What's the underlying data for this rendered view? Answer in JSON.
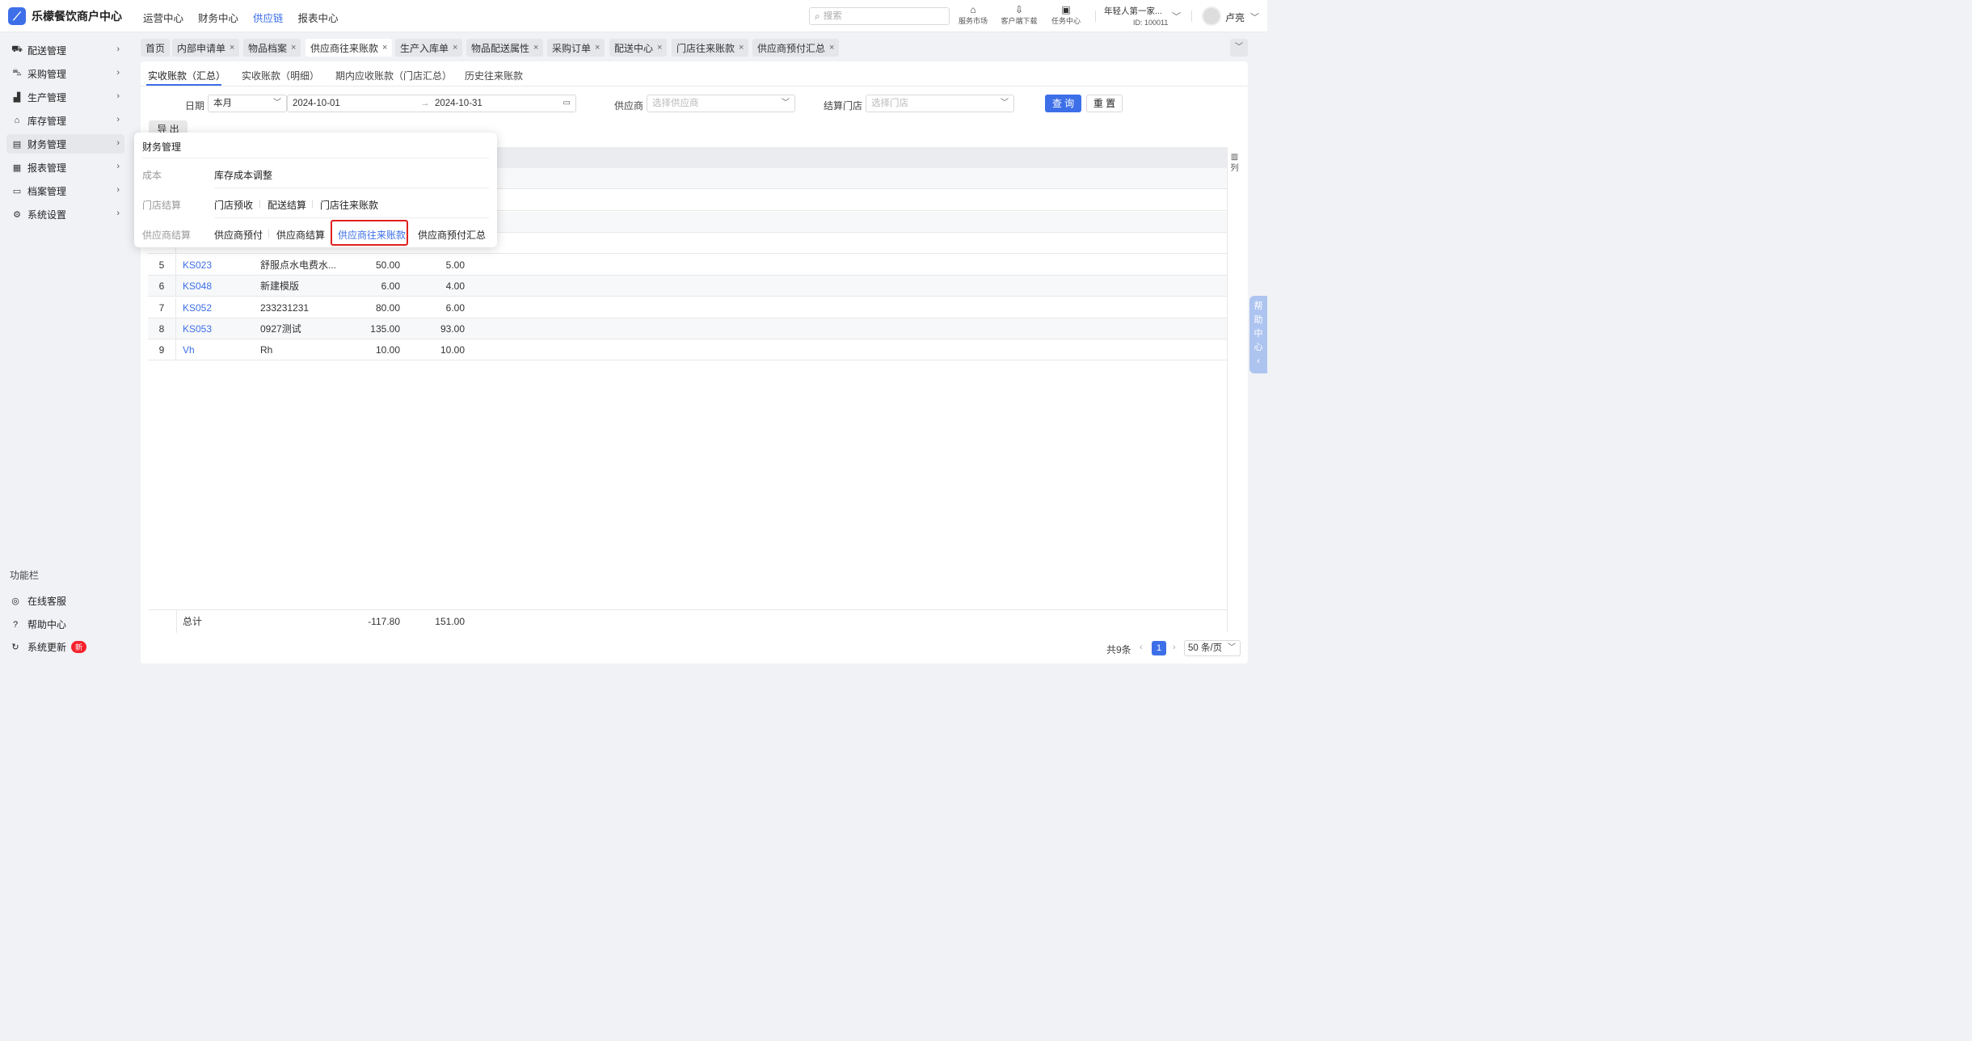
{
  "header": {
    "brand": "乐檬餐饮商户中心",
    "nav": [
      "运营中心",
      "财务中心",
      "供应链",
      "报表中心"
    ],
    "active_nav": "供应链",
    "search_placeholder": "搜索",
    "tools": [
      {
        "label": "服务市场",
        "icon": "shop-icon"
      },
      {
        "label": "客户端下载",
        "icon": "download-icon"
      },
      {
        "label": "任务中心",
        "icon": "clipboard-icon"
      }
    ],
    "store_name": "年轻人第一家...",
    "store_id": "ID: 100011",
    "user_name": "卢亮"
  },
  "sidebar": {
    "items": [
      {
        "label": "配送管理",
        "icon": "truck-icon"
      },
      {
        "label": "采购管理",
        "icon": "cart-icon"
      },
      {
        "label": "生产管理",
        "icon": "factory-icon"
      },
      {
        "label": "库存管理",
        "icon": "warehouse-icon"
      },
      {
        "label": "财务管理",
        "icon": "ledger-icon"
      },
      {
        "label": "报表管理",
        "icon": "report-icon"
      },
      {
        "label": "档案管理",
        "icon": "archive-icon"
      },
      {
        "label": "系统设置",
        "icon": "gear-icon"
      }
    ],
    "active": "财务管理",
    "function_title": "功能栏",
    "functions": [
      {
        "label": "在线客服",
        "icon": "headset-icon"
      },
      {
        "label": "帮助中心",
        "icon": "help-icon"
      },
      {
        "label": "系统更新",
        "icon": "refresh-icon",
        "badge": "新"
      }
    ]
  },
  "tabs": [
    {
      "label": "首页",
      "closable": false
    },
    {
      "label": "内部申请单",
      "closable": true
    },
    {
      "label": "物品档案",
      "closable": true
    },
    {
      "label": "供应商往来账款",
      "closable": true,
      "active": true
    },
    {
      "label": "生产入库单",
      "closable": true
    },
    {
      "label": "物品配送属性",
      "closable": true
    },
    {
      "label": "采购订单",
      "closable": true
    },
    {
      "label": "配送中心",
      "closable": true
    },
    {
      "label": "门店往来账款",
      "closable": true
    },
    {
      "label": "供应商预付汇总",
      "closable": true
    }
  ],
  "subtabs": [
    "实收账款（汇总）",
    "实收账款（明细）",
    "期内应收账款（门店汇总）",
    "历史往来账款"
  ],
  "filters": {
    "date_label": "日期",
    "date_range_type": "本月",
    "date_start": "2024-10-01",
    "date_end": "2024-10-31",
    "supplier_label": "供应商",
    "supplier_placeholder": "选择供应商",
    "store_label": "结算门店",
    "store_placeholder": "选择门店",
    "query_label": "查 询",
    "reset_label": "重 置",
    "export_label": "导 出",
    "columns_label": "列"
  },
  "table": {
    "rows": [
      {
        "idx": "5",
        "code": "KS023",
        "name": "舒服点水电费水...",
        "v1": "50.00",
        "v2": "5.00"
      },
      {
        "idx": "6",
        "code": "KS048",
        "name": "新建模版",
        "v1": "6.00",
        "v2": "4.00"
      },
      {
        "idx": "7",
        "code": "KS052",
        "name": "233231231",
        "v1": "80.00",
        "v2": "6.00"
      },
      {
        "idx": "8",
        "code": "KS053",
        "name": "0927测试",
        "v1": "135.00",
        "v2": "93.00"
      },
      {
        "idx": "9",
        "code": "Vh",
        "name": "Rh",
        "v1": "10.00",
        "v2": "10.00"
      }
    ],
    "total_label": "总计",
    "total_v1": "-117.80",
    "total_v2": "151.00"
  },
  "pagination": {
    "total": "共9条",
    "current": "1",
    "page_size": "50 条/页"
  },
  "help_tab": "帮助中心",
  "popup": {
    "title": "财务管理",
    "groups": [
      {
        "label": "成本",
        "links": [
          "库存成本调整"
        ]
      },
      {
        "label": "门店结算",
        "links": [
          "门店预收",
          "配送结算",
          "门店往来账款"
        ]
      },
      {
        "label": "供应商结算",
        "links": [
          "供应商预付",
          "供应商结算",
          "供应商往来账款",
          "供应商预付汇总"
        ]
      }
    ],
    "highlighted": "供应商往来账款"
  }
}
